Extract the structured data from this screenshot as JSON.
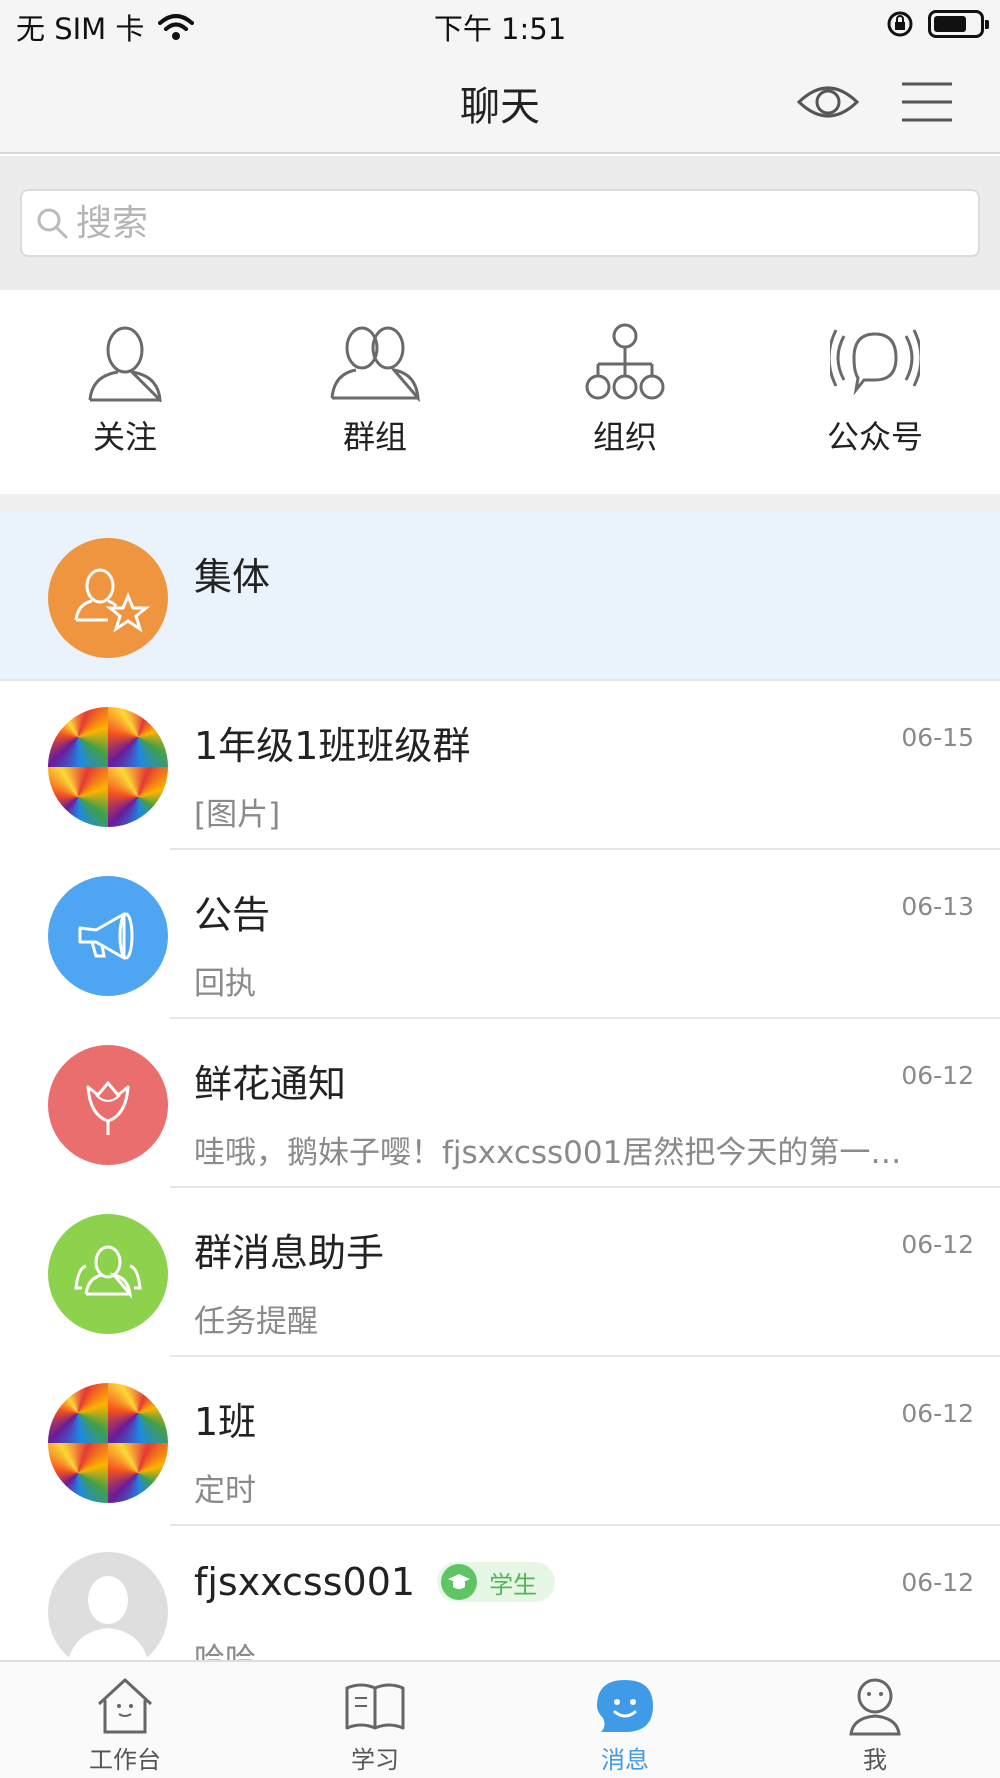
{
  "status_bar": {
    "carrier": "无 SIM 卡",
    "time": "下午 1:51"
  },
  "nav": {
    "title": "聊天"
  },
  "search": {
    "placeholder": "搜索"
  },
  "quick_entries": [
    {
      "label": "关注",
      "icon": "person-outline-icon"
    },
    {
      "label": "群组",
      "icon": "group-outline-icon"
    },
    {
      "label": "组织",
      "icon": "org-tree-icon"
    },
    {
      "label": "公众号",
      "icon": "broadcast-chat-icon"
    }
  ],
  "chats": [
    {
      "name": "集体",
      "time": "",
      "preview": "",
      "avatar": "collective-star-icon",
      "avatar_color": "#f0953f",
      "highlighted": true
    },
    {
      "name": "1年级1班班级群",
      "time": "06-15",
      "preview": "[图片]",
      "avatar": "flower-mosaic-image"
    },
    {
      "name": "公告",
      "time": "06-13",
      "preview": "回执",
      "avatar": "megaphone-icon",
      "avatar_color": "#4ea5f2"
    },
    {
      "name": "鲜花通知",
      "time": "06-12",
      "preview": "哇哦，鹅妹子嘤！fjsxxcss001居然把今天的第一…",
      "avatar": "tulip-icon",
      "avatar_color": "#eb6e6e"
    },
    {
      "name": "群消息助手",
      "time": "06-12",
      "preview": "任务提醒",
      "avatar": "group-assistant-icon",
      "avatar_color": "#8dd24d"
    },
    {
      "name": "1班",
      "time": "06-12",
      "preview": "定时",
      "avatar": "flower-mosaic-image"
    },
    {
      "name": "fjsxxcss001",
      "time": "06-12",
      "preview": "哈哈",
      "avatar": "default-user-icon",
      "badge": "学生"
    }
  ],
  "tabs": [
    {
      "label": "工作台",
      "icon": "house-icon",
      "active": false
    },
    {
      "label": "学习",
      "icon": "book-icon",
      "active": false
    },
    {
      "label": "消息",
      "icon": "message-smile-icon",
      "active": true,
      "color": "#3f9be8"
    },
    {
      "label": "我",
      "icon": "profile-icon",
      "active": false
    }
  ]
}
